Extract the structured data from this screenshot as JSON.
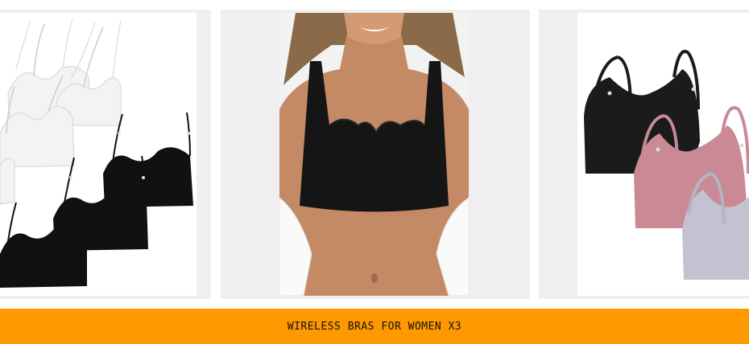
{
  "banner": {
    "title": "WIRELESS BRAS FOR WOMEN X3",
    "background_color": "#ff9900",
    "text_color": "#111111"
  },
  "gallery": {
    "tile_background_color": "#efefef",
    "images": [
      {
        "subject": "pack of white and black scoop bras",
        "icon": "product-photo-icon"
      },
      {
        "subject": "model wearing black scalloped wireless bra",
        "icon": "product-photo-icon"
      },
      {
        "subject": "black, pink and lilac wireless bras",
        "icon": "product-photo-icon"
      }
    ]
  }
}
